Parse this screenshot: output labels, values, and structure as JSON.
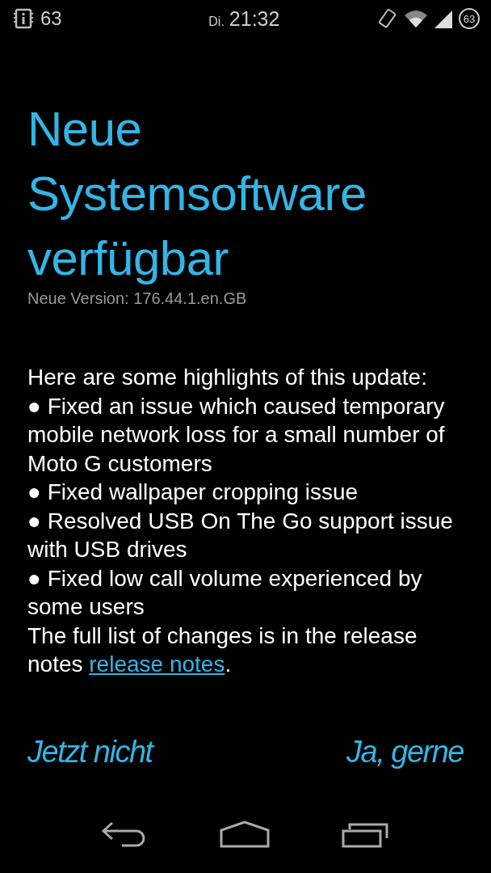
{
  "status_bar": {
    "notification_count": "63",
    "day": "Di.",
    "time": "21:32",
    "battery": "63"
  },
  "title": "Neue Systemsoftware verfügbar",
  "version": "Neue Version: 176.44.1.en.GB",
  "intro": "Here are some highlights of this update:",
  "highlights": [
    "● Fixed an issue which caused temporary mobile network loss for a small number of Moto G customers",
    "● Fixed wallpaper cropping issue",
    "● Resolved USB On The Go support issue with USB drives",
    "● Fixed low call volume experienced by some users"
  ],
  "closing": {
    "text": "The full list of changes is in the release notes",
    "link": "release notes",
    "end": "."
  },
  "buttons": [
    "Jetzt nicht",
    "Ja, gerne"
  ]
}
